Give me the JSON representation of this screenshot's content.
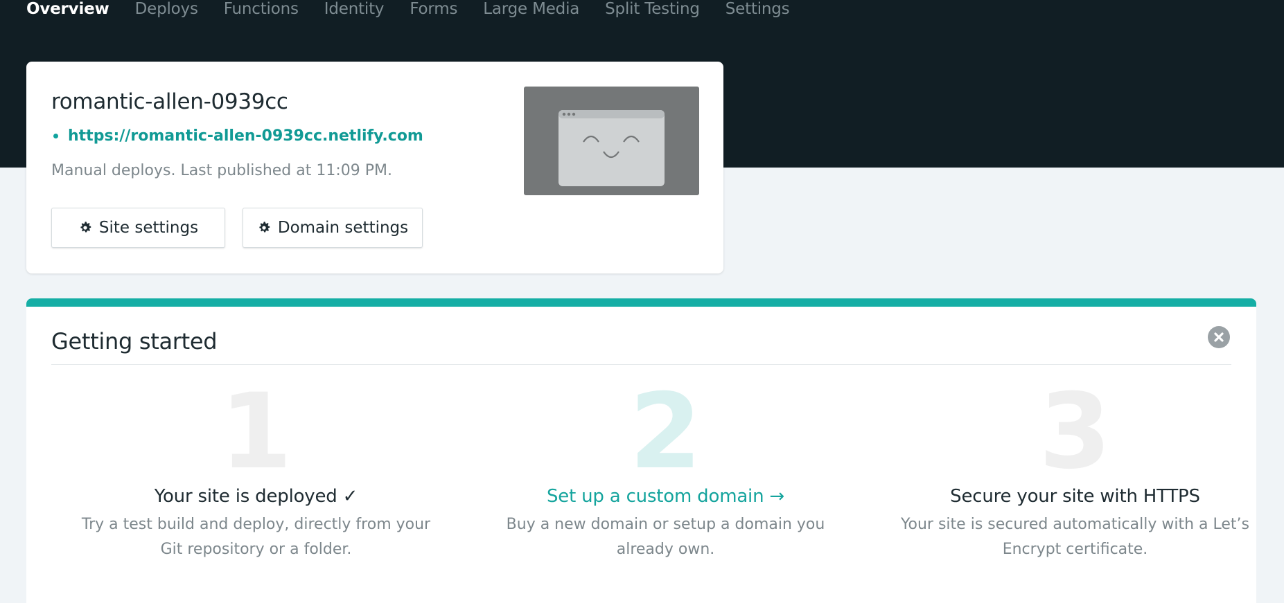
{
  "nav": {
    "items": [
      {
        "label": "Overview",
        "active": true
      },
      {
        "label": "Deploys"
      },
      {
        "label": "Functions"
      },
      {
        "label": "Identity"
      },
      {
        "label": "Forms"
      },
      {
        "label": "Large Media"
      },
      {
        "label": "Split Testing"
      },
      {
        "label": "Settings"
      }
    ]
  },
  "site": {
    "name": "romantic-allen-0939cc",
    "url": "https://romantic-allen-0939cc.netlify.com",
    "status": "Manual deploys. Last published at 11:09 PM.",
    "site_settings_label": "Site settings",
    "domain_settings_label": "Domain settings",
    "preview_icon": "smiley-browser-window-icon"
  },
  "getting_started": {
    "title": "Getting started",
    "steps": [
      {
        "number": "1",
        "title": "Your site is deployed ✓",
        "description": "Try a test build and deploy, directly from your Git repository or a folder."
      },
      {
        "number": "2",
        "title": "Set up a custom domain →",
        "description": "Buy a new domain or setup a domain you already own."
      },
      {
        "number": "3",
        "title": "Secure your site with HTTPS",
        "description": "Your site is secured automatically with a Let’s Encrypt certificate."
      }
    ]
  },
  "colors": {
    "topbar": "#111e24",
    "accent": "#15aea5",
    "link": "#119a95",
    "background": "#f0f4f7"
  }
}
